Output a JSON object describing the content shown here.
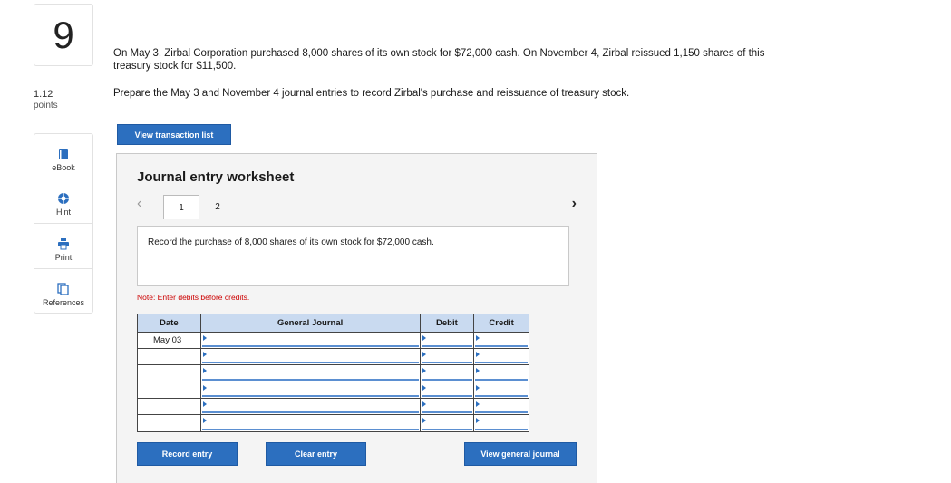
{
  "question": {
    "number": "9",
    "points_value": "1.12",
    "points_label": "points",
    "prompt": "On May 3, Zirbal Corporation purchased 8,000 shares of its own stock for $72,000 cash. On November 4, Zirbal reissued 1,150 shares of this treasury stock for $11,500.",
    "instruction": "Prepare the May 3 and November 4 journal entries to record Zirbal's purchase and reissuance of treasury stock."
  },
  "tools": [
    {
      "label": "eBook",
      "icon": "book-icon"
    },
    {
      "label": "Hint",
      "icon": "hint-icon"
    },
    {
      "label": "Print",
      "icon": "print-icon"
    },
    {
      "label": "References",
      "icon": "references-icon"
    }
  ],
  "buttons": {
    "view_transaction_list": "View transaction list",
    "record_entry": "Record entry",
    "clear_entry": "Clear entry",
    "view_general_journal": "View general journal"
  },
  "worksheet": {
    "title": "Journal entry worksheet",
    "tabs": [
      "1",
      "2"
    ],
    "active_tab": "1",
    "description": "Record the purchase of 8,000 shares of its own stock for $72,000 cash.",
    "note": "Note: Enter debits before credits.",
    "columns": [
      "Date",
      "General Journal",
      "Debit",
      "Credit"
    ],
    "rows": [
      {
        "date": "May 03",
        "account": "",
        "debit": "",
        "credit": ""
      },
      {
        "date": "",
        "account": "",
        "debit": "",
        "credit": ""
      },
      {
        "date": "",
        "account": "",
        "debit": "",
        "credit": ""
      },
      {
        "date": "",
        "account": "",
        "debit": "",
        "credit": ""
      },
      {
        "date": "",
        "account": "",
        "debit": "",
        "credit": ""
      },
      {
        "date": "",
        "account": "",
        "debit": "",
        "credit": ""
      }
    ]
  },
  "colors": {
    "accent_blue": "#2c6fbf",
    "header_blue": "#c9daf0",
    "note_red": "#cc0000"
  }
}
